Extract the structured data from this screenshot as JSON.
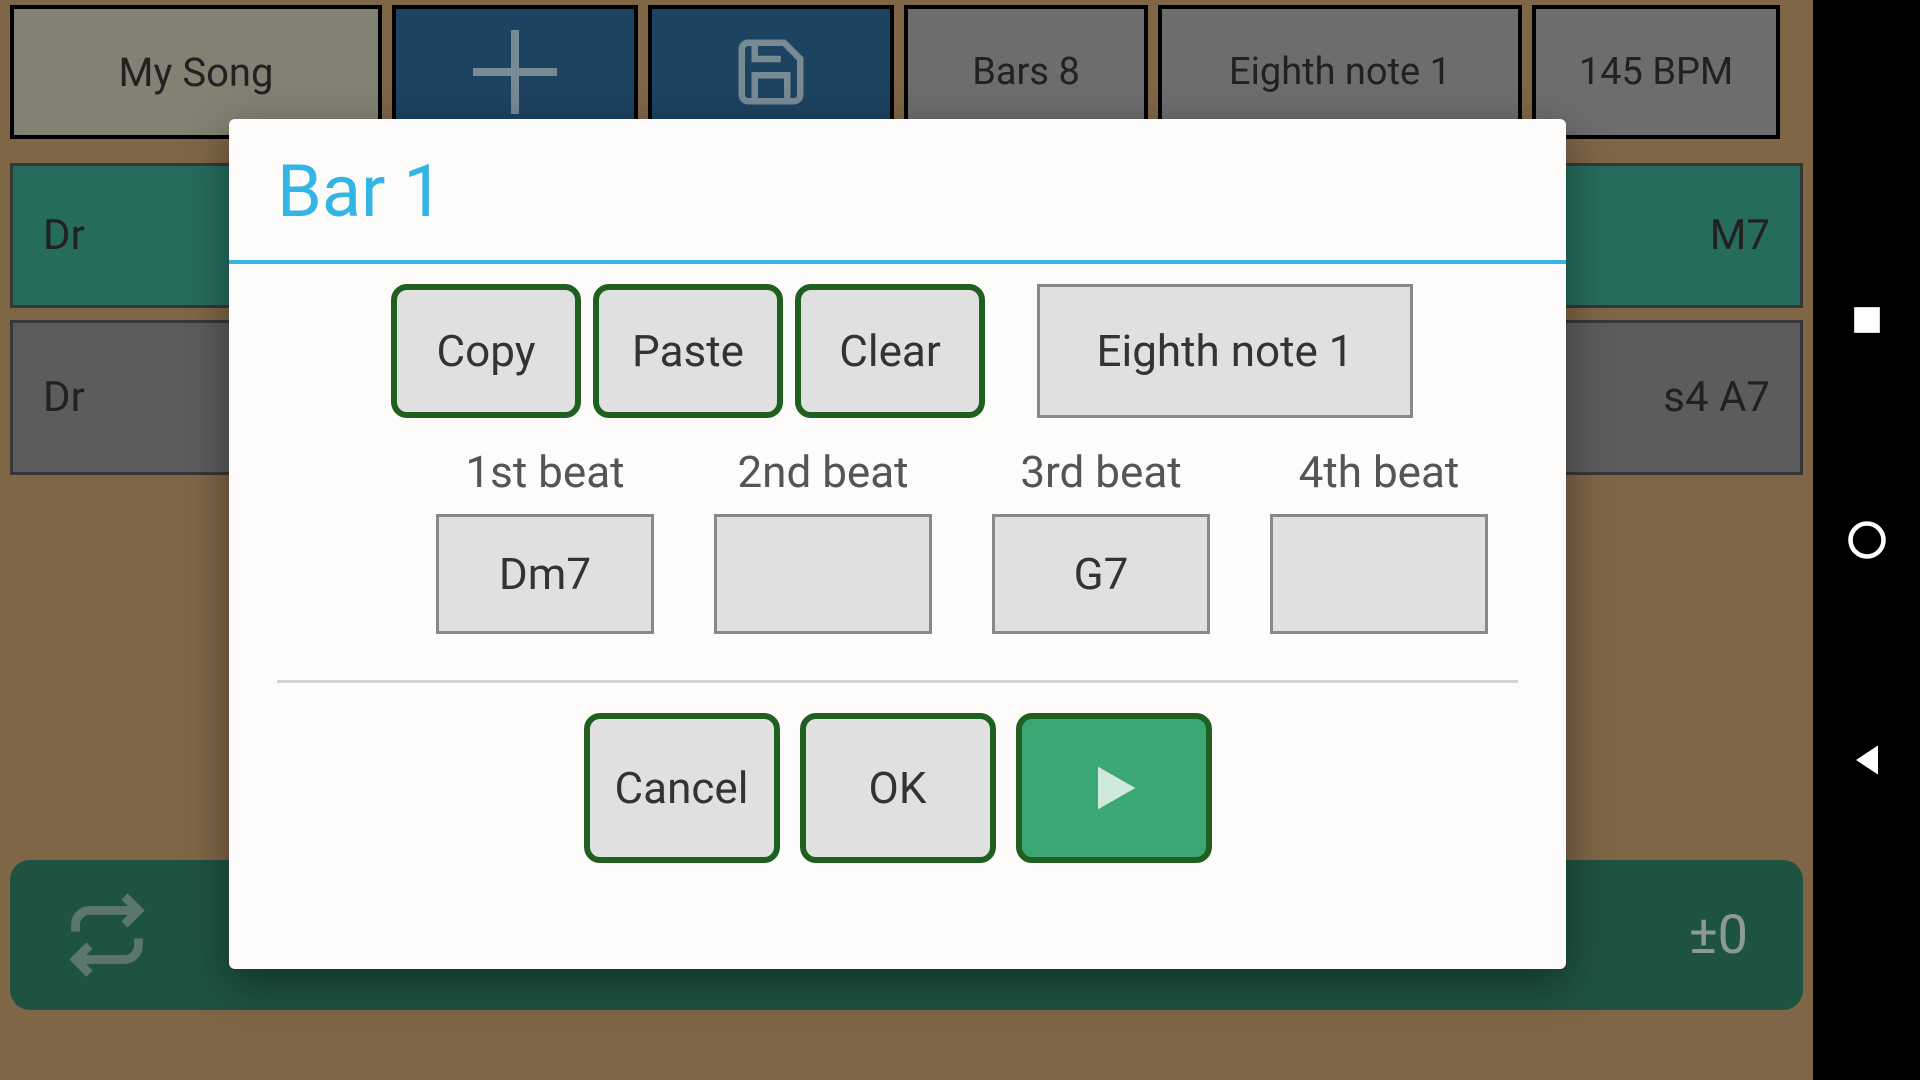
{
  "toolbar": {
    "song_title": "My Song",
    "bars_label": "Bars  8",
    "eighth_label": "Eighth note 1",
    "bpm_label": "145 BPM"
  },
  "bg_rows": {
    "row1_left": "Dr",
    "row1_right": "M7",
    "row2_left": "Dr",
    "row2_right": "s4  A7"
  },
  "dialog": {
    "title": "Bar 1",
    "copy": "Copy",
    "paste": "Paste",
    "clear": "Clear",
    "note_type": "Eighth note 1",
    "beat_labels": [
      "1st beat",
      "2nd beat",
      "3rd beat",
      "4th beat"
    ],
    "beat_values": [
      "Dm7",
      "",
      "G7",
      ""
    ],
    "cancel": "Cancel",
    "ok": "OK"
  },
  "bottom": {
    "transpose": "±0"
  }
}
